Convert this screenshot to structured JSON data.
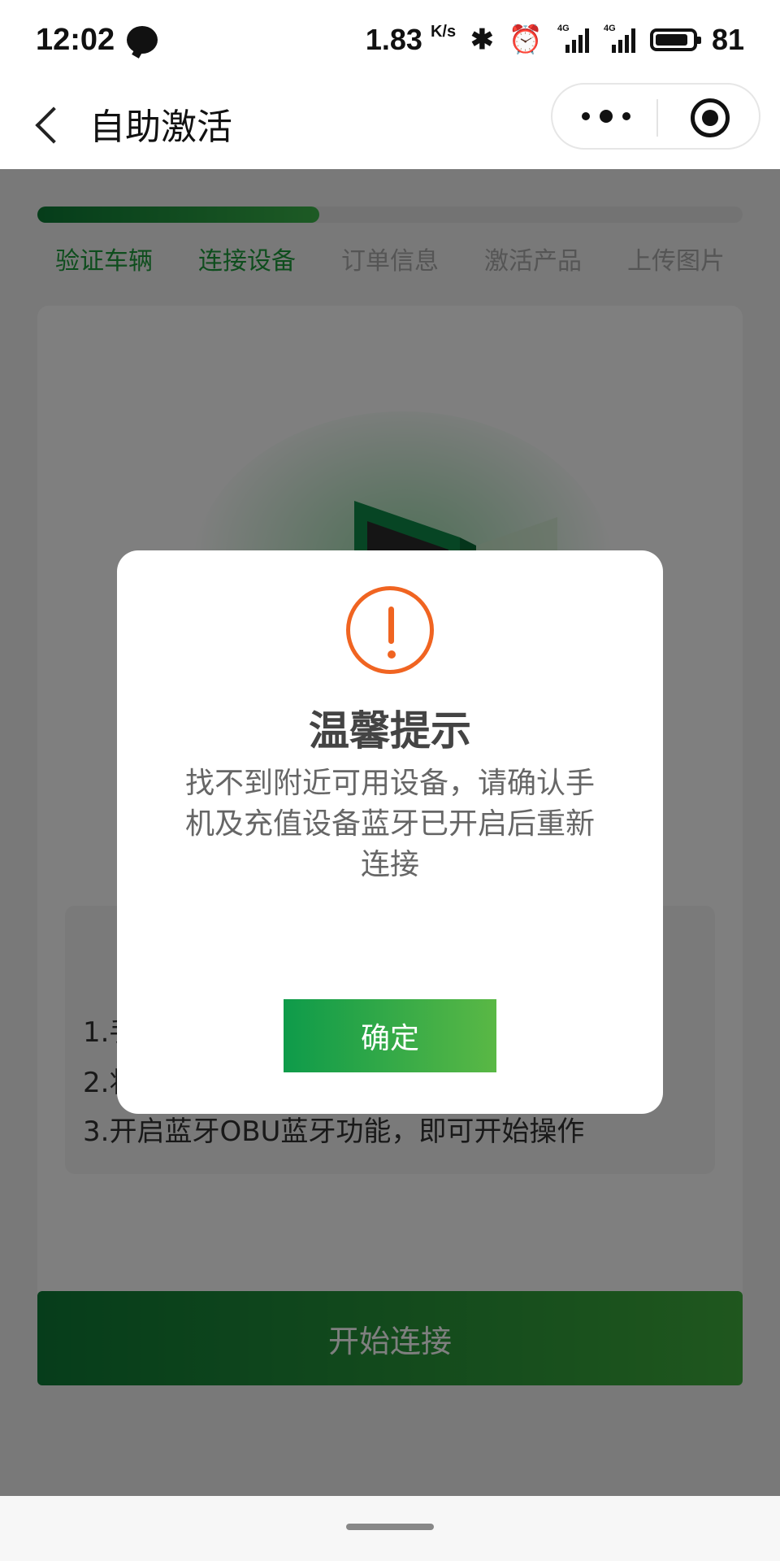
{
  "status_bar": {
    "time": "12:02",
    "speed": "1.83",
    "speed_unit": "K/s",
    "network_1": "4G",
    "network_2": "4G",
    "battery": "81"
  },
  "nav": {
    "title": "自助激活"
  },
  "progress": {
    "fraction": 0.4
  },
  "steps": [
    {
      "label": "验证车辆",
      "done": true
    },
    {
      "label": "连接设备",
      "done": true
    },
    {
      "label": "订单信息",
      "done": false
    },
    {
      "label": "激活产品",
      "done": false
    },
    {
      "label": "上传图片",
      "done": false
    }
  ],
  "instructions": {
    "line1": "1.手",
    "line2": "2.将",
    "line3": "3.开启蓝牙OBU蓝牙功能，即可开始操作"
  },
  "start_button": "开始连接",
  "modal": {
    "title": "温馨提示",
    "message": "找不到附近可用设备，请确认手机及充值设备蓝牙已开启后重新连接",
    "confirm": "确定"
  },
  "colors": {
    "accent_green": "#1c9b3a",
    "warning_orange": "#f06421"
  }
}
